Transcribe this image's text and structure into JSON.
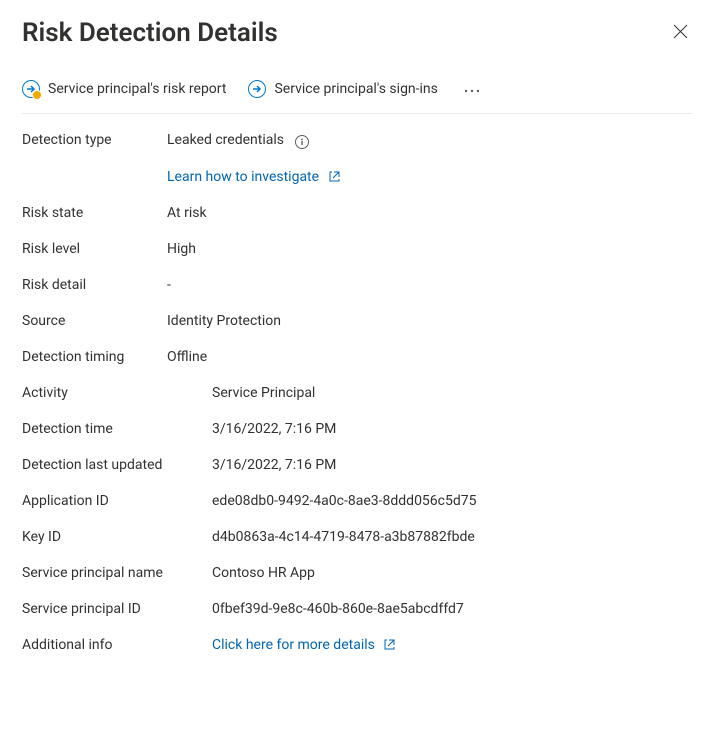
{
  "header": {
    "title": "Risk Detection Details"
  },
  "toolbar": {
    "risk_report_label": "Service principal's risk report",
    "signins_label": "Service principal's sign-ins"
  },
  "links": {
    "investigate": "Learn how to investigate",
    "additional_info": "Click here for more details"
  },
  "labels": {
    "detection_type": "Detection type",
    "risk_state": "Risk state",
    "risk_level": "Risk level",
    "risk_detail": "Risk detail",
    "source": "Source",
    "detection_timing": "Detection timing",
    "activity": "Activity",
    "detection_time": "Detection time",
    "detection_last_updated": "Detection last updated",
    "application_id": "Application ID",
    "key_id": "Key ID",
    "service_principal_name": "Service principal name",
    "service_principal_id": "Service principal ID",
    "additional_info": "Additional info"
  },
  "values": {
    "detection_type": "Leaked credentials",
    "risk_state": "At risk",
    "risk_level": "High",
    "risk_detail": "-",
    "source": "Identity Protection",
    "detection_timing": "Offline",
    "activity": "Service Principal",
    "detection_time": "3/16/2022, 7:16 PM",
    "detection_last_updated": "3/16/2022, 7:16 PM",
    "application_id": "ede08db0-9492-4a0c-8ae3-8ddd056c5d75",
    "key_id": "d4b0863a-4c14-4719-8478-a3b87882fbde",
    "service_principal_name": "Contoso HR App",
    "service_principal_id": "0fbef39d-9e8c-460b-860e-8ae5abcdffd7"
  }
}
